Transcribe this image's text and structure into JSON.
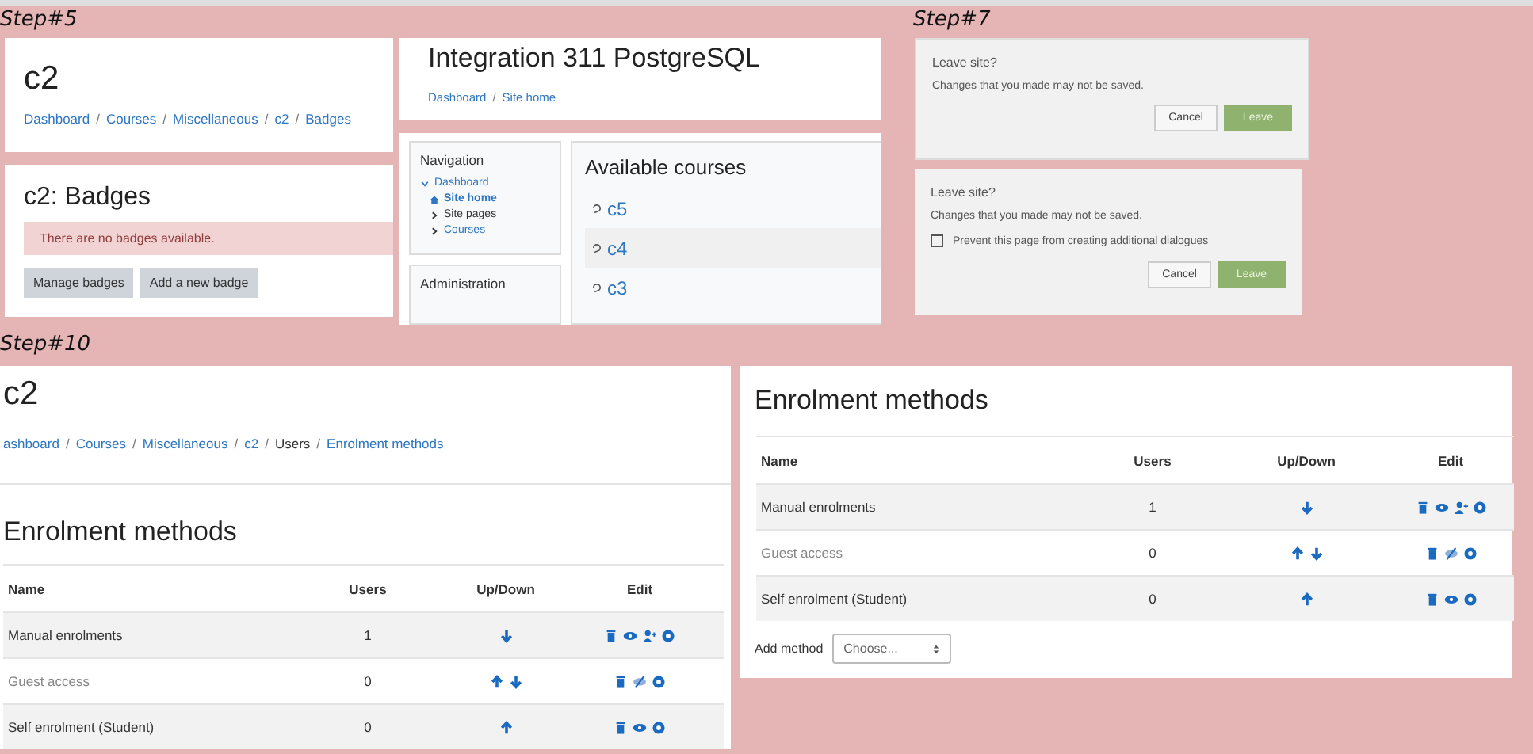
{
  "step5": {
    "label": "Step#5",
    "badges_page": {
      "title": "c2",
      "breadcrumb": {
        "separator": "/",
        "items": [
          {
            "text": "Dashboard",
            "link": true
          },
          {
            "text": "Courses",
            "link": true
          },
          {
            "text": "Miscellaneous",
            "link": true
          },
          {
            "text": "c2",
            "link": true
          },
          {
            "text": "Badges",
            "link": true
          }
        ]
      },
      "heading": "c2: Badges",
      "alert": "There are no badges available.",
      "buttons": [
        "Manage badges",
        "Add a new badge"
      ]
    },
    "site_home": {
      "title": "Integration 311 PostgreSQL",
      "breadcrumb": {
        "separator": "/",
        "items": [
          {
            "text": "Dashboard",
            "link": true
          },
          {
            "text": "Site home",
            "link": true
          }
        ]
      },
      "navigation": {
        "title": "Navigation",
        "items": [
          {
            "label": "Dashboard",
            "expanded": true,
            "children": [
              {
                "label": "Site home",
                "selected": true
              },
              {
                "label": "Site pages",
                "selected": false,
                "expanded": false
              },
              {
                "label": "Courses",
                "selected": false,
                "expanded": false
              }
            ]
          }
        ]
      },
      "administration": {
        "title": "Administration"
      },
      "available_courses": {
        "title": "Available courses",
        "courses": [
          "c5",
          "c4",
          "c3"
        ]
      }
    }
  },
  "step7": {
    "label": "Step#7",
    "dialogs": [
      {
        "title": "Leave site?",
        "message": "Changes that you made may not be saved.",
        "buttons": [
          "Cancel",
          "Leave"
        ]
      },
      {
        "title": "Leave site?",
        "message": "Changes that you made may not be saved.",
        "checkbox": {
          "label": "Prevent this page from creating additional dialogues",
          "checked": false
        },
        "buttons": [
          "Cancel",
          "Leave"
        ]
      }
    ]
  },
  "step10": {
    "label": "Step#10",
    "course_page": {
      "title": "c2",
      "breadcrumb": {
        "separator": "/",
        "items": [
          {
            "text": "ashboard",
            "link": true
          },
          {
            "text": "Courses",
            "link": true
          },
          {
            "text": "Miscellaneous",
            "link": true
          },
          {
            "text": "c2",
            "link": true
          },
          {
            "text": "Users",
            "link": false
          },
          {
            "text": "Enrolment methods",
            "link": true
          }
        ]
      },
      "heading": "Enrolment methods",
      "table": {
        "columns": [
          "Name",
          "Users",
          "Up/Down",
          "Edit"
        ],
        "rows": [
          {
            "name": "Manual enrolments",
            "users": "1",
            "visible": true,
            "up": false,
            "down": true,
            "enrol": true
          },
          {
            "name": "Guest access",
            "users": "0",
            "visible": false,
            "up": true,
            "down": true,
            "enrol": false
          },
          {
            "name": "Self enrolment (Student)",
            "users": "0",
            "visible": true,
            "up": true,
            "down": false,
            "enrol": false
          }
        ]
      }
    },
    "enrolment_page": {
      "heading": "Enrolment methods",
      "table": {
        "columns": [
          "Name",
          "Users",
          "Up/Down",
          "Edit"
        ],
        "rows": [
          {
            "name": "Manual enrolments",
            "users": "1",
            "visible": true,
            "up": false,
            "down": true,
            "enrol": true
          },
          {
            "name": "Guest access",
            "users": "0",
            "visible": false,
            "up": true,
            "down": true,
            "enrol": false
          },
          {
            "name": "Self enrolment (Student)",
            "users": "0",
            "visible": true,
            "up": true,
            "down": false,
            "enrol": false
          }
        ]
      },
      "add_method": {
        "label": "Add method",
        "select": "Choose..."
      }
    }
  }
}
